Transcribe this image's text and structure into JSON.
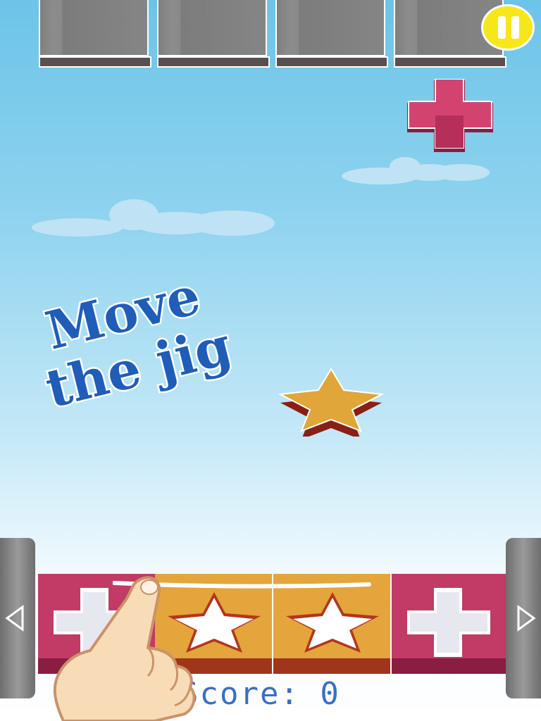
{
  "game": {
    "hint_line1": "Move",
    "hint_line2": "the jig",
    "score_label": "Score: 0"
  },
  "hud": {
    "pause_icon": "pause-icon",
    "left_icon": "left-arrow-icon",
    "right_icon": "right-arrow-icon"
  },
  "pieces": {
    "falling": [
      "plus-cross",
      "star"
    ],
    "tray": [
      "plus-cross",
      "star",
      "star",
      "plus-cross"
    ]
  },
  "colors": {
    "sky_top": "#6cc4e8",
    "pause_yellow": "#f6e71a",
    "cross_pink": "#c83a6a",
    "star_orange": "#e0a63a",
    "hint_blue": "#1f5db8",
    "score_blue": "#3a6fc4"
  }
}
